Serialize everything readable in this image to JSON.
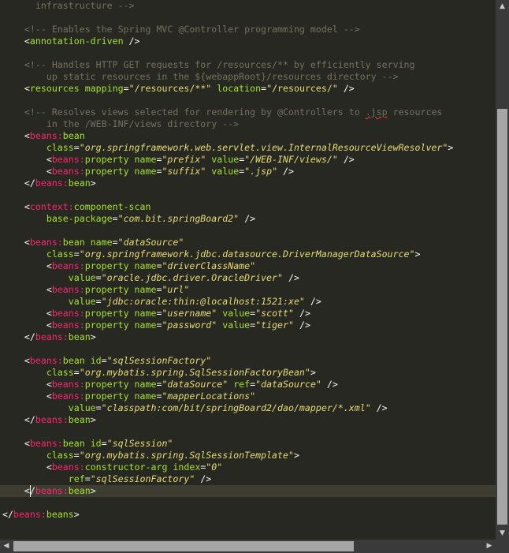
{
  "editor": {
    "current_line": 41,
    "caret_line": 41,
    "caret_column": 5,
    "lines": [
      [
        [
          "comment",
          "      infrastructure -->"
        ]
      ],
      [],
      [
        [
          "comment",
          "    <!-- Enables the Spring MVC @Controller programming model -->"
        ]
      ],
      [
        [
          "plain",
          "    "
        ],
        [
          "punct",
          "<"
        ],
        [
          "attr",
          "annotation-driven"
        ],
        [
          "punct",
          " />"
        ]
      ],
      [],
      [
        [
          "comment",
          "    <!-- Handles HTTP GET requests for /resources/** by efficiently serving"
        ]
      ],
      [
        [
          "comment",
          "        up static resources in the ${webappRoot}/resources directory -->"
        ]
      ],
      [
        [
          "plain",
          "    "
        ],
        [
          "punct",
          "<"
        ],
        [
          "attr",
          "resources"
        ],
        [
          "plain",
          " "
        ],
        [
          "attr",
          "mapping"
        ],
        [
          "eq",
          "="
        ],
        [
          "string",
          "\"/resources/**\""
        ],
        [
          "plain",
          " "
        ],
        [
          "attr",
          "location"
        ],
        [
          "eq",
          "="
        ],
        [
          "string",
          "\"/resources/\""
        ],
        [
          "punct",
          " />"
        ]
      ],
      [],
      [
        [
          "comment",
          "    <!-- Resolves views selected for rendering by @Controllers to "
        ],
        [
          "comment spell",
          ".jsp"
        ],
        [
          "comment",
          " resources"
        ]
      ],
      [
        [
          "comment",
          "        in the /WEB-INF/views directory -->"
        ]
      ],
      [
        [
          "plain",
          "    "
        ],
        [
          "punct",
          "<"
        ],
        [
          "tag",
          "beans:"
        ],
        [
          "attr",
          "bean"
        ]
      ],
      [
        [
          "plain",
          "        "
        ],
        [
          "attr",
          "class"
        ],
        [
          "eq",
          "="
        ],
        [
          "class",
          "\"org.springframework.web.servlet.view.InternalResourceViewResolver\""
        ],
        [
          "punct",
          ">"
        ]
      ],
      [
        [
          "plain",
          "        "
        ],
        [
          "punct",
          "<"
        ],
        [
          "tag",
          "beans:"
        ],
        [
          "attr",
          "property"
        ],
        [
          "plain",
          " "
        ],
        [
          "attr",
          "name"
        ],
        [
          "eq",
          "="
        ],
        [
          "class",
          "\"prefix\""
        ],
        [
          "plain",
          " "
        ],
        [
          "attr",
          "value"
        ],
        [
          "eq",
          "="
        ],
        [
          "class",
          "\"/WEB-INF/views/\""
        ],
        [
          "punct",
          " />"
        ]
      ],
      [
        [
          "plain",
          "        "
        ],
        [
          "punct",
          "<"
        ],
        [
          "tag",
          "beans:"
        ],
        [
          "attr",
          "property"
        ],
        [
          "plain",
          " "
        ],
        [
          "attr",
          "name"
        ],
        [
          "eq",
          "="
        ],
        [
          "class",
          "\"suffix\""
        ],
        [
          "plain",
          " "
        ],
        [
          "attr",
          "value"
        ],
        [
          "eq",
          "="
        ],
        [
          "class",
          "\".jsp\""
        ],
        [
          "punct",
          " />"
        ]
      ],
      [
        [
          "plain",
          "    "
        ],
        [
          "punct",
          "</"
        ],
        [
          "tag",
          "beans:"
        ],
        [
          "attr",
          "bean"
        ],
        [
          "punct",
          ">"
        ]
      ],
      [],
      [
        [
          "plain",
          "    "
        ],
        [
          "punct",
          "<"
        ],
        [
          "tag",
          "context:"
        ],
        [
          "attr",
          "component-scan"
        ]
      ],
      [
        [
          "plain",
          "        "
        ],
        [
          "attr",
          "base-package"
        ],
        [
          "eq",
          "="
        ],
        [
          "class",
          "\"com.bit.springBoard2\""
        ],
        [
          "punct",
          " />"
        ]
      ],
      [],
      [
        [
          "plain",
          "    "
        ],
        [
          "punct",
          "<"
        ],
        [
          "tag",
          "beans:"
        ],
        [
          "attr",
          "bean"
        ],
        [
          "plain",
          " "
        ],
        [
          "attr",
          "name"
        ],
        [
          "eq",
          "="
        ],
        [
          "class",
          "\"dataSource\""
        ]
      ],
      [
        [
          "plain",
          "        "
        ],
        [
          "attr",
          "class"
        ],
        [
          "eq",
          "="
        ],
        [
          "class",
          "\"org.springframework.jdbc.datasource.DriverManagerDataSource\""
        ],
        [
          "punct",
          ">"
        ]
      ],
      [
        [
          "plain",
          "        "
        ],
        [
          "punct",
          "<"
        ],
        [
          "tag",
          "beans:"
        ],
        [
          "attr",
          "property"
        ],
        [
          "plain",
          " "
        ],
        [
          "attr",
          "name"
        ],
        [
          "eq",
          "="
        ],
        [
          "class",
          "\"driverClassName\""
        ]
      ],
      [
        [
          "plain",
          "            "
        ],
        [
          "attr",
          "value"
        ],
        [
          "eq",
          "="
        ],
        [
          "class",
          "\"oracle.jdbc.driver.OracleDriver\""
        ],
        [
          "punct",
          " />"
        ]
      ],
      [
        [
          "plain",
          "        "
        ],
        [
          "punct",
          "<"
        ],
        [
          "tag",
          "beans:"
        ],
        [
          "attr",
          "property"
        ],
        [
          "plain",
          " "
        ],
        [
          "attr",
          "name"
        ],
        [
          "eq",
          "="
        ],
        [
          "class",
          "\"url\""
        ]
      ],
      [
        [
          "plain",
          "            "
        ],
        [
          "attr",
          "value"
        ],
        [
          "eq",
          "="
        ],
        [
          "class",
          "\"jdbc:oracle:thin:@localhost:1521:xe\""
        ],
        [
          "punct",
          " />"
        ]
      ],
      [
        [
          "plain",
          "        "
        ],
        [
          "punct",
          "<"
        ],
        [
          "tag",
          "beans:"
        ],
        [
          "attr",
          "property"
        ],
        [
          "plain",
          " "
        ],
        [
          "attr",
          "name"
        ],
        [
          "eq",
          "="
        ],
        [
          "class",
          "\"username\""
        ],
        [
          "plain",
          " "
        ],
        [
          "attr",
          "value"
        ],
        [
          "eq",
          "="
        ],
        [
          "class",
          "\"scott\""
        ],
        [
          "punct",
          " />"
        ]
      ],
      [
        [
          "plain",
          "        "
        ],
        [
          "punct",
          "<"
        ],
        [
          "tag",
          "beans:"
        ],
        [
          "attr",
          "property"
        ],
        [
          "plain",
          " "
        ],
        [
          "attr",
          "name"
        ],
        [
          "eq",
          "="
        ],
        [
          "class",
          "\"password\""
        ],
        [
          "plain",
          " "
        ],
        [
          "attr",
          "value"
        ],
        [
          "eq",
          "="
        ],
        [
          "class",
          "\"tiger\""
        ],
        [
          "punct",
          " />"
        ]
      ],
      [
        [
          "plain",
          "    "
        ],
        [
          "punct",
          "</"
        ],
        [
          "tag",
          "beans:"
        ],
        [
          "attr",
          "bean"
        ],
        [
          "punct",
          ">"
        ]
      ],
      [],
      [
        [
          "plain",
          "    "
        ],
        [
          "punct",
          "<"
        ],
        [
          "tag",
          "beans:"
        ],
        [
          "attr",
          "bean"
        ],
        [
          "plain",
          " "
        ],
        [
          "attr",
          "id"
        ],
        [
          "eq",
          "="
        ],
        [
          "class",
          "\"sqlSessionFactory\""
        ]
      ],
      [
        [
          "plain",
          "        "
        ],
        [
          "attr",
          "class"
        ],
        [
          "eq",
          "="
        ],
        [
          "class",
          "\"org.mybatis.spring.SqlSessionFactoryBean\""
        ],
        [
          "punct",
          ">"
        ]
      ],
      [
        [
          "plain",
          "        "
        ],
        [
          "punct",
          "<"
        ],
        [
          "tag",
          "beans:"
        ],
        [
          "attr",
          "property"
        ],
        [
          "plain",
          " "
        ],
        [
          "attr",
          "name"
        ],
        [
          "eq",
          "="
        ],
        [
          "class",
          "\"dataSource\""
        ],
        [
          "plain",
          " "
        ],
        [
          "attr",
          "ref"
        ],
        [
          "eq",
          "="
        ],
        [
          "class",
          "\"dataSource\""
        ],
        [
          "punct",
          " />"
        ]
      ],
      [
        [
          "plain",
          "        "
        ],
        [
          "punct",
          "<"
        ],
        [
          "tag",
          "beans:"
        ],
        [
          "attr",
          "property"
        ],
        [
          "plain",
          " "
        ],
        [
          "attr",
          "name"
        ],
        [
          "eq",
          "="
        ],
        [
          "class",
          "\"mapperLocations\""
        ]
      ],
      [
        [
          "plain",
          "            "
        ],
        [
          "attr",
          "value"
        ],
        [
          "eq",
          "="
        ],
        [
          "class",
          "\"classpath:com/bit/springBoard2/dao/mapper/*.xml\""
        ],
        [
          "punct",
          " />"
        ]
      ],
      [
        [
          "plain",
          "    "
        ],
        [
          "punct",
          "</"
        ],
        [
          "tag",
          "beans:"
        ],
        [
          "attr",
          "bean"
        ],
        [
          "punct",
          ">"
        ]
      ],
      [],
      [
        [
          "plain",
          "    "
        ],
        [
          "punct",
          "<"
        ],
        [
          "tag",
          "beans:"
        ],
        [
          "attr",
          "bean"
        ],
        [
          "plain",
          " "
        ],
        [
          "attr",
          "id"
        ],
        [
          "eq",
          "="
        ],
        [
          "class",
          "\"sqlSession\""
        ]
      ],
      [
        [
          "plain",
          "        "
        ],
        [
          "attr",
          "class"
        ],
        [
          "eq",
          "="
        ],
        [
          "class",
          "\"org.mybatis.spring.SqlSessionTemplate\""
        ],
        [
          "punct",
          ">"
        ]
      ],
      [
        [
          "plain",
          "        "
        ],
        [
          "punct",
          "<"
        ],
        [
          "tag",
          "beans:"
        ],
        [
          "attr",
          "constructor-arg"
        ],
        [
          "plain",
          " "
        ],
        [
          "attr",
          "index"
        ],
        [
          "eq",
          "="
        ],
        [
          "class",
          "\"0\""
        ]
      ],
      [
        [
          "plain",
          "            "
        ],
        [
          "attr",
          "ref"
        ],
        [
          "eq",
          "="
        ],
        [
          "class",
          "\"sqlSessionFactory\""
        ],
        [
          "punct",
          " />"
        ]
      ],
      [
        [
          "plain",
          "    "
        ],
        [
          "punct",
          "</"
        ],
        [
          "tag",
          "beans:"
        ],
        [
          "attr",
          "bean"
        ],
        [
          "punct",
          ">"
        ]
      ],
      [],
      [
        [
          "punct",
          "</"
        ],
        [
          "tag",
          "beans:"
        ],
        [
          "attr",
          "beans"
        ],
        [
          "punct",
          ">"
        ]
      ]
    ]
  },
  "scrollbars": {
    "up_arrow": "▲",
    "down_arrow": "▼",
    "left_arrow": "◀",
    "right_arrow": "▶"
  },
  "colors": {
    "background": "#272822",
    "comment": "#75715e",
    "tag": "#f92672",
    "attribute": "#a6e22e",
    "string": "#e6db74",
    "text": "#f8f8f2",
    "current_line": "#3e3d32"
  }
}
